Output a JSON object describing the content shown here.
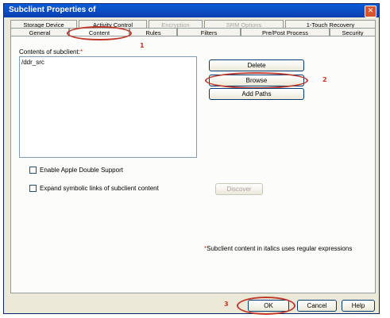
{
  "window": {
    "title": "Subclient Properties of"
  },
  "tabs_row1": [
    {
      "label": "Storage Device",
      "disabled": false
    },
    {
      "label": "Activity Control",
      "disabled": false
    },
    {
      "label": "Encryption",
      "disabled": true
    },
    {
      "label": "SRM Options",
      "disabled": true
    },
    {
      "label": "1-Touch Recovery",
      "disabled": false
    }
  ],
  "tabs_row2": [
    {
      "label": "General"
    },
    {
      "label": "Content",
      "active": true
    },
    {
      "label": "Rules"
    },
    {
      "label": "Filters"
    },
    {
      "label": "Pre/Post Process"
    },
    {
      "label": "Security"
    }
  ],
  "content": {
    "contents_label": "Contents of subclient:",
    "required_mark": "*",
    "items": [
      "/ddr_src"
    ]
  },
  "buttons": {
    "delete": "Delete",
    "browse": "Browse",
    "add_paths": "Add Paths",
    "discover": "Discover",
    "ok": "OK",
    "cancel": "Cancel",
    "help": "Help"
  },
  "checkboxes": {
    "apple_double": {
      "label": "Enable Apple Double Support",
      "checked": false
    },
    "symbolic_links": {
      "label": "Expand symbolic links of subclient content",
      "checked": false
    }
  },
  "note": {
    "asterisk": "*",
    "text": "Subclient content in italics uses regular expressions"
  },
  "callouts": {
    "c1": "1",
    "c2": "2",
    "c3": "3"
  },
  "colors": {
    "title_bar": "#0a3fb0",
    "callout_red": "#d4311b"
  }
}
